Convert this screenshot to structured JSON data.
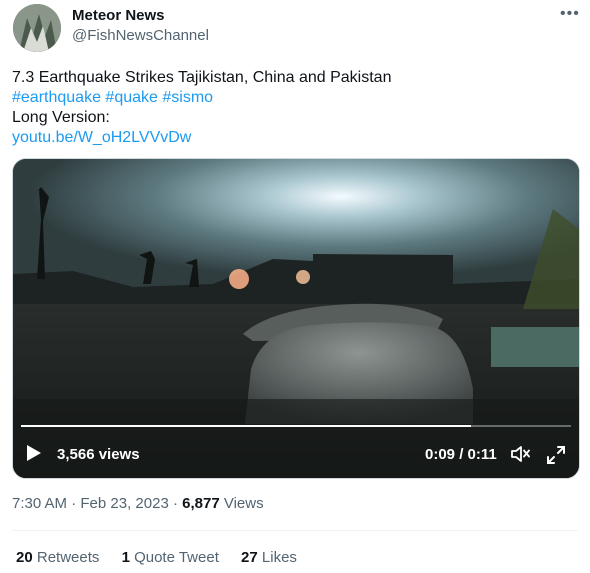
{
  "author": {
    "display_name": "Meteor News",
    "handle": "@FishNewsChannel",
    "more_icon": "more-horizontal-icon"
  },
  "tweet": {
    "headline": "7.3 Earthquake Strikes Tajikistan, China and Pakistan",
    "hashtags": [
      "#earthquake",
      "#quake",
      "#sismo"
    ],
    "long_version_label": "Long Version:",
    "link_text": "youtu.be/W_oH2LVVvDw"
  },
  "video": {
    "views": "3,566 views",
    "time": "0:09 / 0:11",
    "progress": 0.818,
    "icons": [
      "play-icon",
      "volume-icon",
      "fullscreen-icon"
    ]
  },
  "meta": {
    "time": "7:30 AM",
    "date": "Feb 23, 2023",
    "sep": "·",
    "views_count": "6,877",
    "views_label": "Views"
  },
  "stats": {
    "retweets_count": "20",
    "retweets_label": "Retweets",
    "quotes_count": "1",
    "quotes_label": "Quote Tweet",
    "likes_count": "27",
    "likes_label": "Likes"
  }
}
